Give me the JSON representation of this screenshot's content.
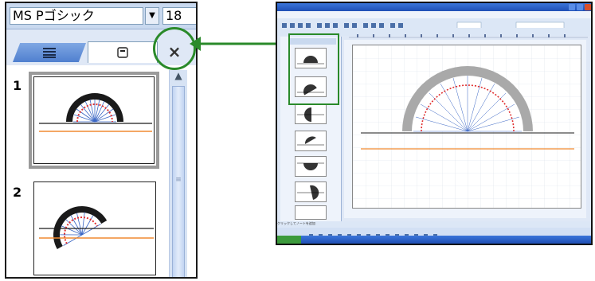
{
  "left_panel": {
    "font_name": "MS Pゴシック",
    "font_size": "18",
    "slides": [
      {
        "number": "1",
        "selected": true
      },
      {
        "number": "2",
        "selected": false
      }
    ]
  },
  "icons": {
    "outline_tab": "outline-lines-icon",
    "slides_tab": "slide-page-icon",
    "close": "close-x-icon",
    "dropdown": "chevron-down-icon",
    "scroll_up": "scroll-up-icon"
  },
  "glyphs": {
    "close": "×",
    "dropdown": "▼",
    "scroll_up": "▲",
    "grip": "≡"
  },
  "colors": {
    "callout": "#2a8a2a",
    "protractor_dark": "#1a1a1a",
    "protractor_light": "#9a9a9a",
    "red_marks": "#e03030",
    "blue_lines": "#3a66c4",
    "orange_line": "#f08a30",
    "taskbar": "#1f4fb5"
  },
  "right_screenshot": {
    "status_text": "クリックしてノートを追加"
  }
}
